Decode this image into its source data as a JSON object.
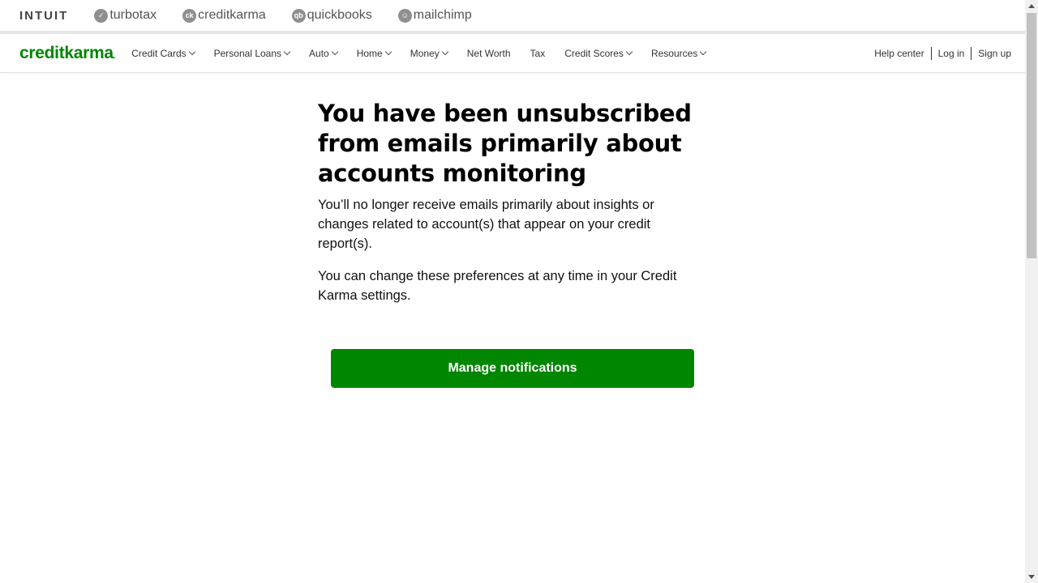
{
  "family_bar": {
    "intuit": "INTUIT",
    "brands": [
      {
        "label": "turbotax",
        "icon": "check-circle-icon",
        "mark": "✓"
      },
      {
        "label": "creditkarma",
        "icon": "ck-circle-icon",
        "mark": "ck"
      },
      {
        "label": "quickbooks",
        "icon": "qb-circle-icon",
        "mark": "qb"
      },
      {
        "label": "mailchimp",
        "icon": "mailchimp-circle-icon",
        "mark": "☺"
      }
    ]
  },
  "nav": {
    "logo": "creditkarma",
    "logo_suffix": ".",
    "items": [
      {
        "label": "Credit Cards",
        "dropdown": true
      },
      {
        "label": "Personal Loans",
        "dropdown": true
      },
      {
        "label": "Auto",
        "dropdown": true
      },
      {
        "label": "Home",
        "dropdown": true
      },
      {
        "label": "Money",
        "dropdown": true
      },
      {
        "label": "Net Worth",
        "dropdown": false
      },
      {
        "label": "Tax",
        "dropdown": false
      },
      {
        "label": "Credit Scores",
        "dropdown": true
      },
      {
        "label": "Resources",
        "dropdown": true
      }
    ],
    "help_center": "Help center",
    "log_in": "Log in",
    "sign_up": "Sign up"
  },
  "main": {
    "headline": "You have been unsubscribed from emails primarily about accounts monitoring",
    "paragraph_1": "You’ll no longer receive emails primarily about insights or changes related to account(s) that appear on your credit report(s).",
    "paragraph_2": "You can change these preferences at any time in your Credit Karma settings.",
    "cta_label": "Manage notifications"
  },
  "colors": {
    "brand_green": "#008600",
    "text": "#000000"
  }
}
